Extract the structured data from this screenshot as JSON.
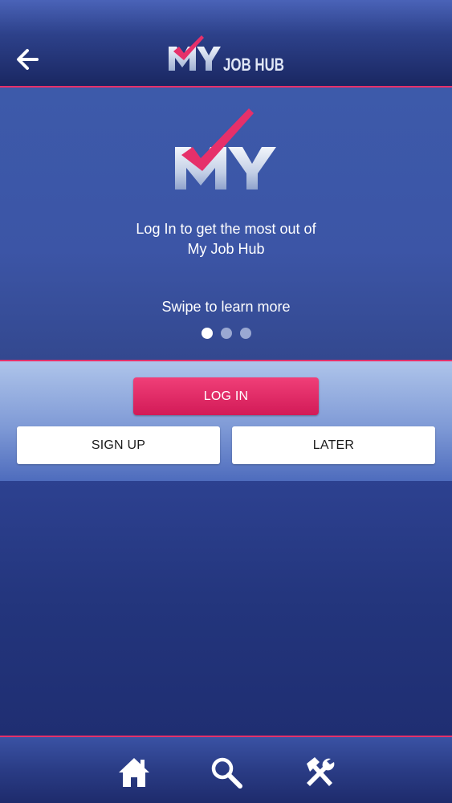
{
  "header": {
    "logo_text": "MY JOB HUB",
    "back_icon": "arrow-left-icon"
  },
  "hero": {
    "logo_text": "MY",
    "line1": "Log In to get the most out of",
    "line2": "My Job Hub",
    "swipe_text": "Swipe to learn more",
    "page_indicator": {
      "total": 3,
      "active": 1
    }
  },
  "actions": {
    "login_label": "LOG IN",
    "signup_label": "SIGN UP",
    "later_label": "LATER"
  },
  "tabbar": {
    "items": [
      {
        "icon": "home-icon"
      },
      {
        "icon": "search-icon"
      },
      {
        "icon": "tools-icon"
      }
    ]
  },
  "colors": {
    "accent": "#e6306a",
    "primary_button": "#e02a63",
    "navy": "#2b3d84"
  }
}
